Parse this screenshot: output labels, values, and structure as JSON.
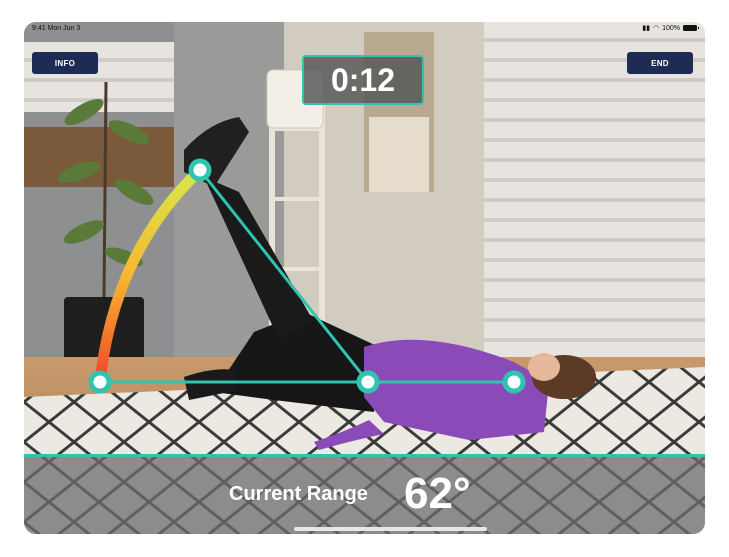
{
  "status_bar": {
    "time": "9:41 Mon Jun 3",
    "battery": "100%"
  },
  "buttons": {
    "info_label": "INFO",
    "end_label": "END"
  },
  "timer": {
    "value": "0:12"
  },
  "range": {
    "label": "Current Range",
    "value": "62°"
  },
  "colors": {
    "accent": "#2ec4b0",
    "button_bg": "#1e2b55",
    "arc_start": "#f0442a",
    "arc_mid": "#f7b731",
    "arc_end": "#d6e84a"
  }
}
